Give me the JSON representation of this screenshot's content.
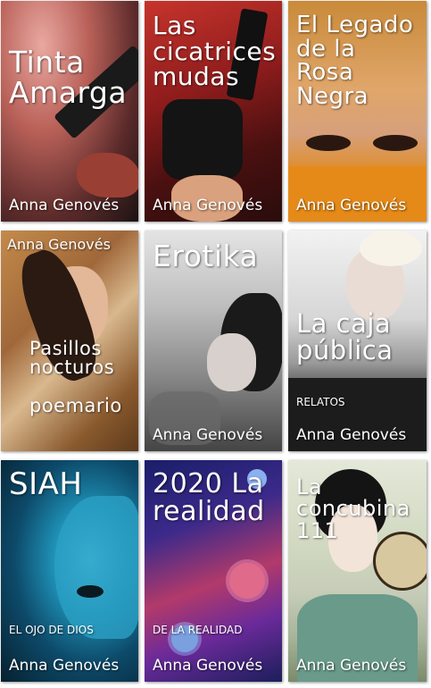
{
  "colors": {
    "text": "#ffffff",
    "page_bg": "#ffffff"
  },
  "books": [
    {
      "title": "Tinta\nAmarga",
      "author": "Anna Genovés",
      "subtitle": ""
    },
    {
      "title": "Las\ncicatrices\nmudas",
      "author": "Anna Genovés",
      "subtitle": ""
    },
    {
      "title": "El Legado\nde la\nRosa\nNegra",
      "author": "Anna Genovés",
      "subtitle": ""
    },
    {
      "title": "Pasillos\nnocturos\n\npoemario",
      "author": "Anna Genovés",
      "subtitle": ""
    },
    {
      "title": "Erotika",
      "author": "Anna Genovés",
      "subtitle": ""
    },
    {
      "title": "La caja\npública",
      "author": "Anna Genovés",
      "subtitle": "RELATOS"
    },
    {
      "title": "SIAH",
      "author": "Anna Genovés",
      "subtitle": "EL OJO DE DIOS"
    },
    {
      "title": "2020 La\nrealidad",
      "author": "Anna Genovés",
      "subtitle": "DE LA REALIDAD"
    },
    {
      "title": "La\nconcubina\n111",
      "author": "Anna Genovés",
      "subtitle": ""
    }
  ]
}
